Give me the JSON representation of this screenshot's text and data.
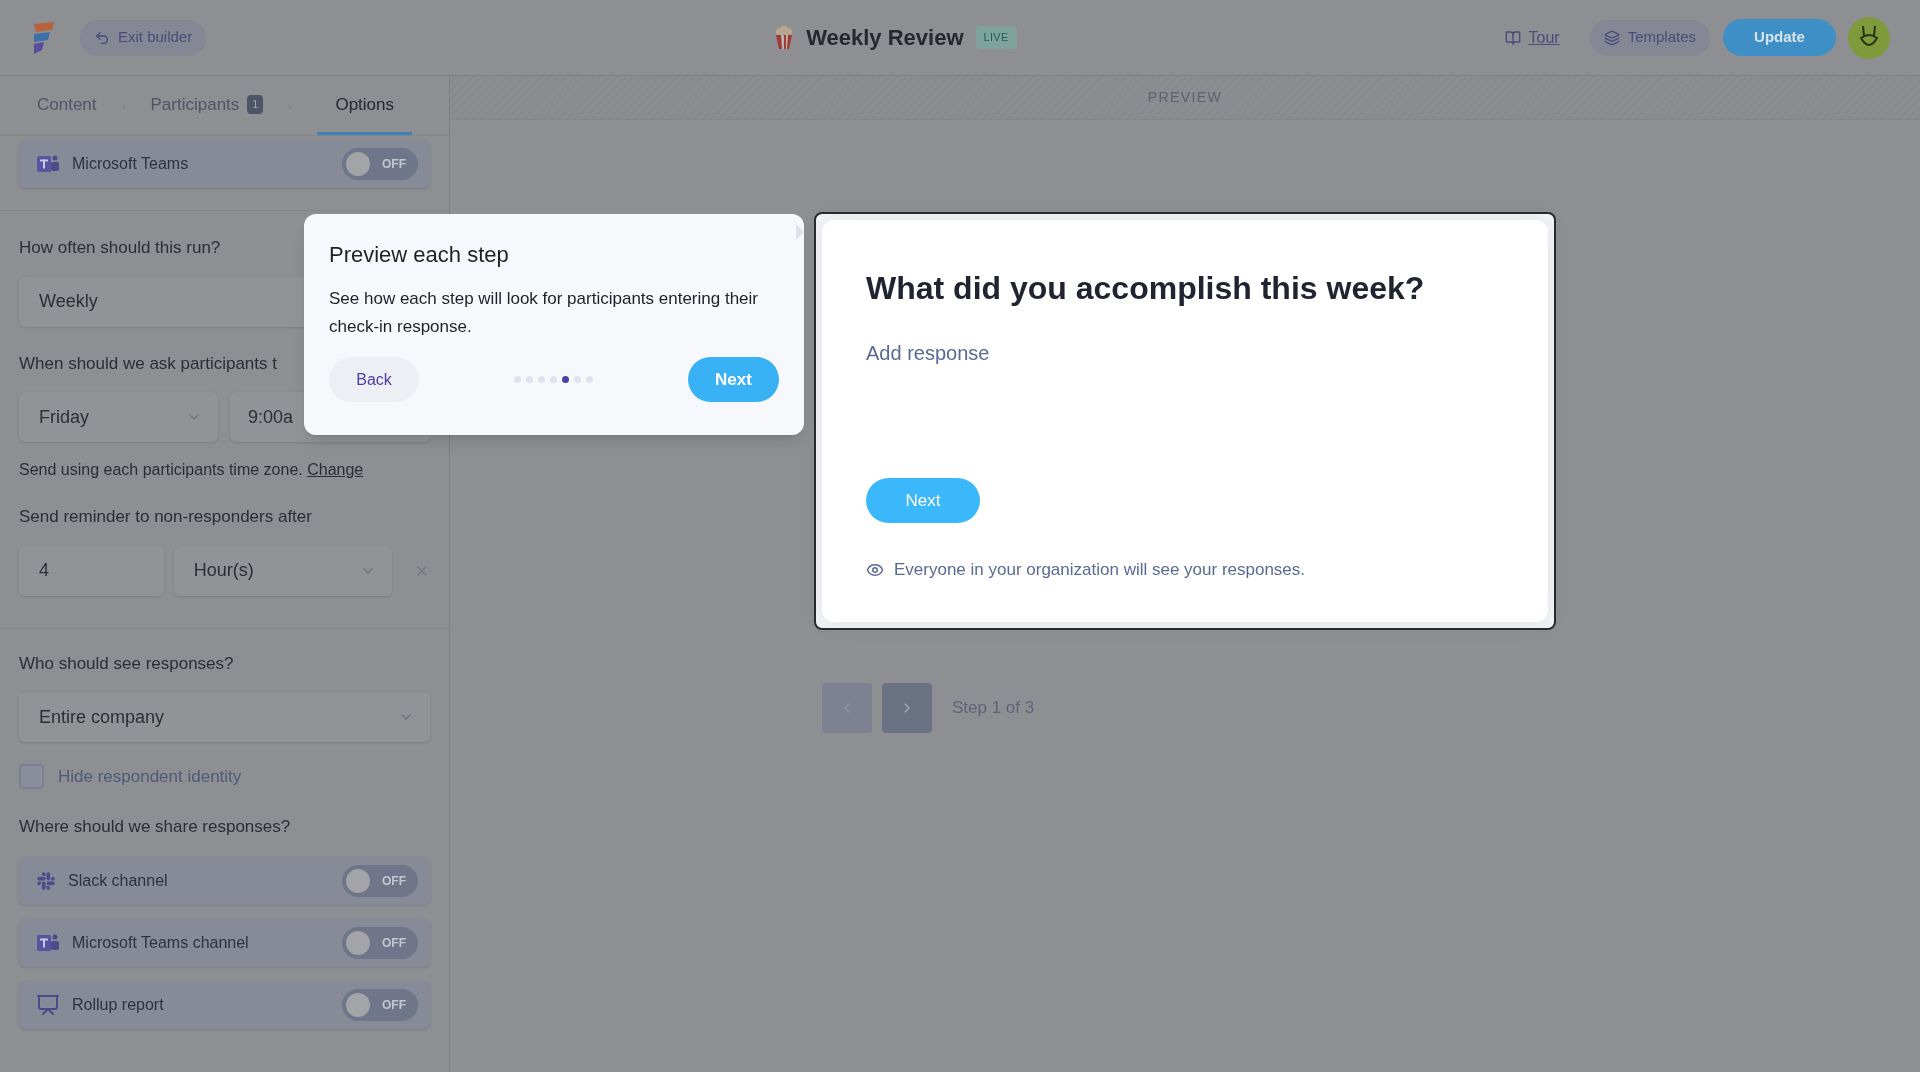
{
  "header": {
    "exit_label": "Exit builder",
    "title": "Weekly Review",
    "badge": "LIVE",
    "tour": "Tour",
    "templates": "Templates",
    "update": "Update"
  },
  "steps": [
    {
      "label": "Content",
      "selected": false
    },
    {
      "label": "Participants",
      "count": "1",
      "selected": false
    },
    {
      "label": "Options",
      "selected": true
    }
  ],
  "top_integrations": [
    {
      "kind": "teams",
      "label": "Microsoft Teams",
      "on": false,
      "state_label": "OFF"
    }
  ],
  "frequency": {
    "label": "How often should this run?",
    "value": "Weekly"
  },
  "schedule": {
    "label": "When should we ask participants t",
    "day": "Friday",
    "time": "9:00a"
  },
  "timezone": {
    "text": "Send using each participants time zone.",
    "link": "Change"
  },
  "reminder": {
    "label": "Send reminder to non-responders after",
    "amount": "4",
    "unit": "Hour(s)"
  },
  "visibility": {
    "label": "Who should see responses?",
    "value": "Entire company"
  },
  "hide_identity": {
    "label": "Hide respondent identity",
    "checked": false
  },
  "share": {
    "label": "Where should we share responses?",
    "items": [
      {
        "kind": "slack",
        "label": "Slack channel",
        "on": false,
        "state_label": "OFF"
      },
      {
        "kind": "teams",
        "label": "Microsoft Teams channel",
        "on": false,
        "state_label": "OFF"
      },
      {
        "kind": "rollup",
        "label": "Rollup report",
        "on": false,
        "state_label": "OFF"
      }
    ]
  },
  "preview": {
    "label": "PREVIEW",
    "question": "What did you accomplish this week?",
    "placeholder": "Add response",
    "next": "Next",
    "notice": "Everyone in your organization will see your responses.",
    "step": "Step 1 of 3"
  },
  "tour": {
    "title": "Preview each step",
    "body": "See how each step will look for participants entering their check-in response.",
    "back": "Back",
    "next": "Next",
    "dots": [
      {
        "selected": false
      },
      {
        "selected": false
      },
      {
        "selected": false
      },
      {
        "selected": false
      },
      {
        "selected": true
      },
      {
        "selected": false
      },
      {
        "selected": false
      }
    ]
  }
}
